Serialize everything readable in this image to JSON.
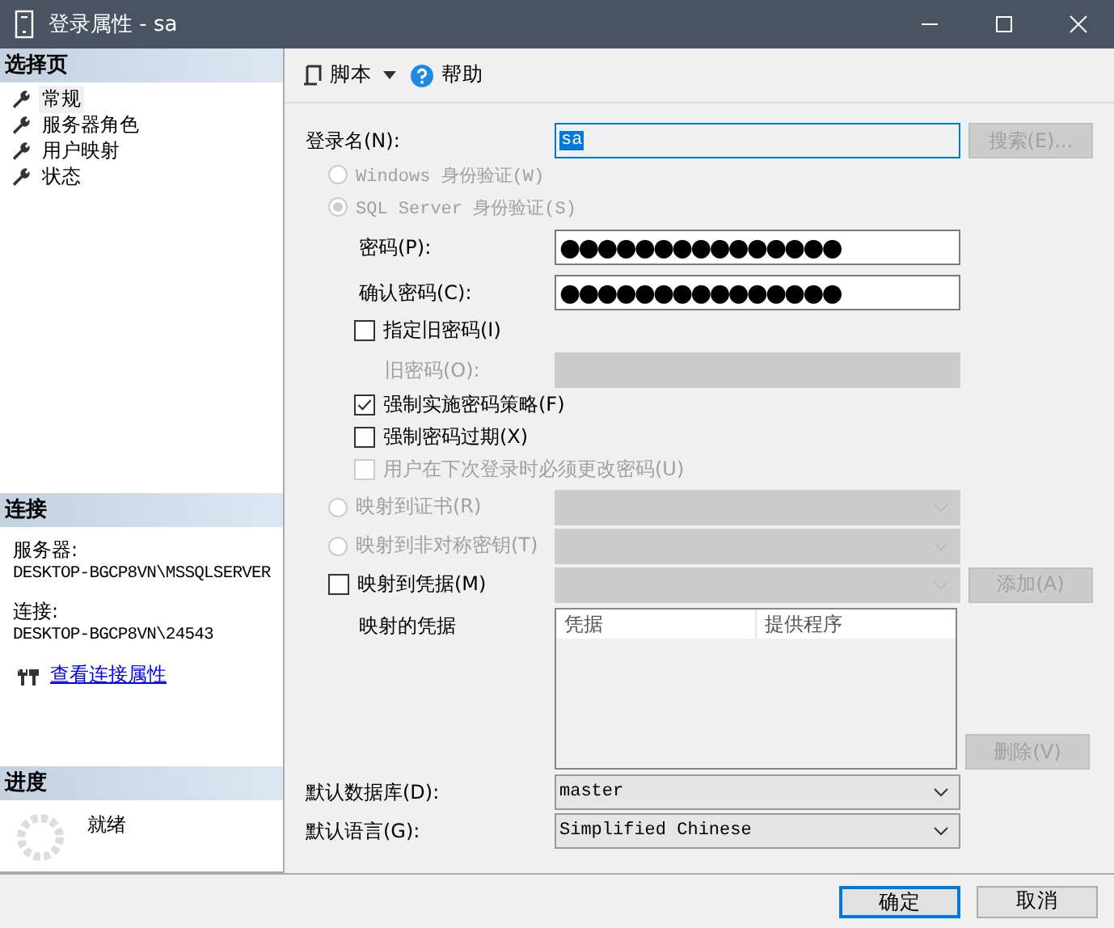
{
  "window": {
    "title": "登录属性 - sa"
  },
  "sidebar": {
    "title": "选择页",
    "pages": [
      {
        "label": "常规",
        "selected": true
      },
      {
        "label": "服务器角色",
        "selected": false
      },
      {
        "label": "用户映射",
        "selected": false
      },
      {
        "label": "状态",
        "selected": false
      }
    ]
  },
  "connection": {
    "title": "连接",
    "server_label": "服务器:",
    "server": "DESKTOP-BGCP8VN\\MSSQLSERVER",
    "connection_label": "连接:",
    "connection": "DESKTOP-BGCP8VN\\24543",
    "link": "查看连接属性"
  },
  "progress": {
    "title": "进度",
    "status": "就绪"
  },
  "toolbar": {
    "script": "脚本",
    "help": "帮助"
  },
  "form": {
    "login_name": {
      "label": "登录名(N):",
      "value": "sa",
      "button": "搜索(E)..."
    },
    "auth": [
      {
        "label": "Windows 身份验证(W)",
        "selected": false,
        "disabled": true
      },
      {
        "label": "SQL Server 身份验证(S)",
        "selected": true,
        "disabled": true
      }
    ],
    "password": {
      "label": "密码(P):",
      "value": "●●●●●●●●●●●●●●●"
    },
    "confirm_password": {
      "label": "确认密码(C):",
      "value": "●●●●●●●●●●●●●●●"
    },
    "specify_old_password": {
      "label": "指定旧密码(I)",
      "checked": false
    },
    "old_password": {
      "label": "旧密码(O):",
      "disabled": true
    },
    "policy_checks": [
      {
        "label": "强制实施密码策略(F)",
        "checked": true,
        "disabled": false
      },
      {
        "label": "强制密码过期(X)",
        "checked": false,
        "disabled": false
      },
      {
        "label": "用户在下次登录时必须更改密码(U)",
        "checked": false,
        "disabled": true
      }
    ],
    "mappings": [
      {
        "kind": "radio",
        "label": "映射到证书(R)",
        "selected": false,
        "disabled": true
      },
      {
        "kind": "radio",
        "label": "映射到非对称密钥(T)",
        "selected": false,
        "disabled": true
      },
      {
        "kind": "checkbox",
        "label": "映射到凭据(M)",
        "checked": false,
        "disabled": false,
        "button": "添加(A)"
      }
    ],
    "mapped_credentials": {
      "label": "映射的凭据",
      "columns": [
        "凭据",
        "提供程序"
      ],
      "button": "删除(V)"
    },
    "default_database": {
      "label": "默认数据库(D):",
      "value": "master"
    },
    "default_language": {
      "label": "默认语言(G):",
      "value": "Simplified Chinese"
    }
  },
  "buttons": [
    {
      "label": "确定",
      "default": true
    },
    {
      "label": "取消",
      "default": false
    }
  ]
}
